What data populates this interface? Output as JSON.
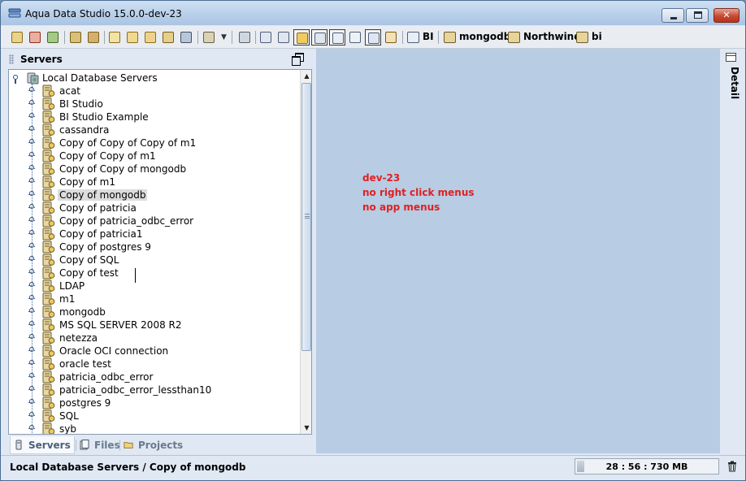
{
  "window": {
    "title": "Aqua Data Studio 15.0.0-dev-23"
  },
  "toolbar": {
    "named_buttons": [
      {
        "label": "BI",
        "icon": "bi-icon"
      },
      {
        "label": "mongodb",
        "icon": "server-connection-icon"
      },
      {
        "label": "Northwind",
        "icon": "server-connection-icon"
      },
      {
        "label": "bi",
        "icon": "server-connection-icon"
      }
    ]
  },
  "servers_panel": {
    "title": "Servers",
    "root_label": "Local Database Servers",
    "items": [
      "acat",
      "BI Studio",
      "BI Studio Example",
      "cassandra",
      "Copy of Copy of Copy of m1",
      "Copy of Copy of m1",
      "Copy of Copy of mongodb",
      "Copy of m1",
      "Copy of mongodb",
      "Copy of patricia",
      "Copy of patricia_odbc_error",
      "Copy of patricia1",
      "Copy of postgres 9",
      "Copy of SQL",
      "Copy of test",
      "LDAP",
      "m1",
      "mongodb",
      "MS SQL SERVER 2008 R2",
      "netezza",
      "Oracle OCI connection",
      "oracle test",
      "patricia_odbc_error",
      "patricia_odbc_error_lessthan10",
      "postgres 9",
      "SQL",
      "syb"
    ],
    "selected_item": "Copy of mongodb",
    "tabs": [
      {
        "label": "Servers",
        "active": true
      },
      {
        "label": "Files",
        "active": false
      },
      {
        "label": "Projects",
        "active": false
      }
    ]
  },
  "main": {
    "notes": [
      "dev-23",
      "no right click menus",
      "no app menus"
    ],
    "note_color": "#e02020"
  },
  "detail_strip": {
    "label": "Detail"
  },
  "statusbar": {
    "path": "Local Database Servers / Copy of mongodb",
    "memory": "28 : 56 : 730 MB",
    "memory_fraction": 0.05
  }
}
